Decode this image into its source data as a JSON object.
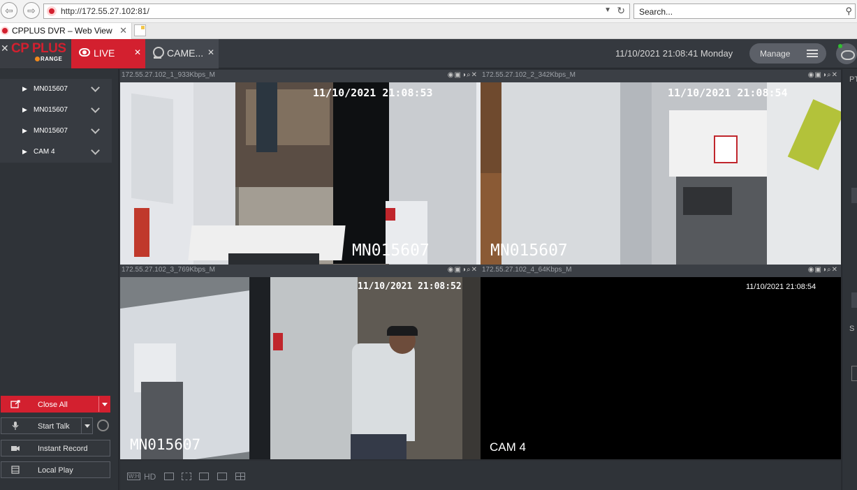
{
  "browser": {
    "url": "http://172.55.27.102:81/",
    "search_placeholder": "Search...",
    "tab_title": "CPPLUS DVR – Web View"
  },
  "header": {
    "logo_main": "CP PLUS",
    "logo_sub": "RANGE",
    "live_tab": "LIVE",
    "camera_tab": "CAME...",
    "datetime": "11/10/2021 21:08:41 Monday",
    "manage_label": "Manage"
  },
  "sidebar": {
    "devices": [
      "MN015607",
      "MN015607",
      "MN015607",
      "CAM 4"
    ],
    "buttons": {
      "close_all": "Close All",
      "start_talk": "Start Talk",
      "instant_record": "Instant Record",
      "local_play": "Local Play"
    }
  },
  "panes": [
    {
      "title": "172.55.27.102_1_933Kbps_M",
      "time": "11/10/2021  21:08:53",
      "name": "MN015607"
    },
    {
      "title": "172.55.27.102_2_342Kbps_M",
      "time": "11/10/2021  21:08:54",
      "name": "MN015607"
    },
    {
      "title": "172.55.27.102_3_769Kbps_M",
      "time": "11/10/2021  21:08:52",
      "name": "MN015607"
    },
    {
      "title": "172.55.27.102_4_64Kbps_M",
      "time": "11/10/2021  21:08:54",
      "name": "CAM 4"
    }
  ],
  "bottom_toolbar": {
    "hd_label": "HD"
  },
  "right_panel": {
    "labels": [
      "PT",
      "S"
    ]
  },
  "colors": {
    "accent": "#d3202f",
    "active_pane": "#43a643"
  }
}
